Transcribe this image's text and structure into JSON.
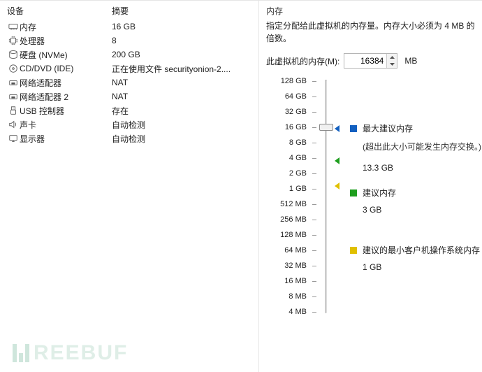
{
  "headers": {
    "device": "设备",
    "summary": "摘要"
  },
  "devices": [
    {
      "name": "内存",
      "value": "16 GB",
      "icon": "memory-icon"
    },
    {
      "name": "处理器",
      "value": "8",
      "icon": "cpu-icon"
    },
    {
      "name": "硬盘 (NVMe)",
      "value": "200 GB",
      "icon": "disk-icon"
    },
    {
      "name": "CD/DVD (IDE)",
      "value": "正在使用文件 securityonion-2....",
      "icon": "cd-icon"
    },
    {
      "name": "网络适配器",
      "value": "NAT",
      "icon": "nic-icon"
    },
    {
      "name": "网络适配器 2",
      "value": "NAT",
      "icon": "nic-icon"
    },
    {
      "name": "USB 控制器",
      "value": "存在",
      "icon": "usb-icon"
    },
    {
      "name": "声卡",
      "value": "自动检测",
      "icon": "sound-icon"
    },
    {
      "name": "显示器",
      "value": "自动检测",
      "icon": "display-icon"
    }
  ],
  "panel": {
    "title": "内存",
    "desc": "指定分配给此虚拟机的内存量。内存大小必须为 4 MB 的倍数。",
    "field_label": "此虚拟机的内存(M):",
    "value": "16384",
    "unit": "MB"
  },
  "ticks": [
    "128 GB",
    "64 GB",
    "32 GB",
    "16 GB",
    "8 GB",
    "4 GB",
    "2 GB",
    "1 GB",
    "512 MB",
    "256 MB",
    "128 MB",
    "64 MB",
    "32 MB",
    "16 MB",
    "8 MB",
    "4 MB"
  ],
  "ann": {
    "max_title": "最大建议内存",
    "max_note": "(超出此大小可能发生内存交换。)",
    "max_val": "13.3 GB",
    "rec_title": "建议内存",
    "rec_val": "3 GB",
    "min_title": "建议的最小客户机操作系统内存",
    "min_val": "1 GB"
  },
  "watermark": "REEBUF"
}
